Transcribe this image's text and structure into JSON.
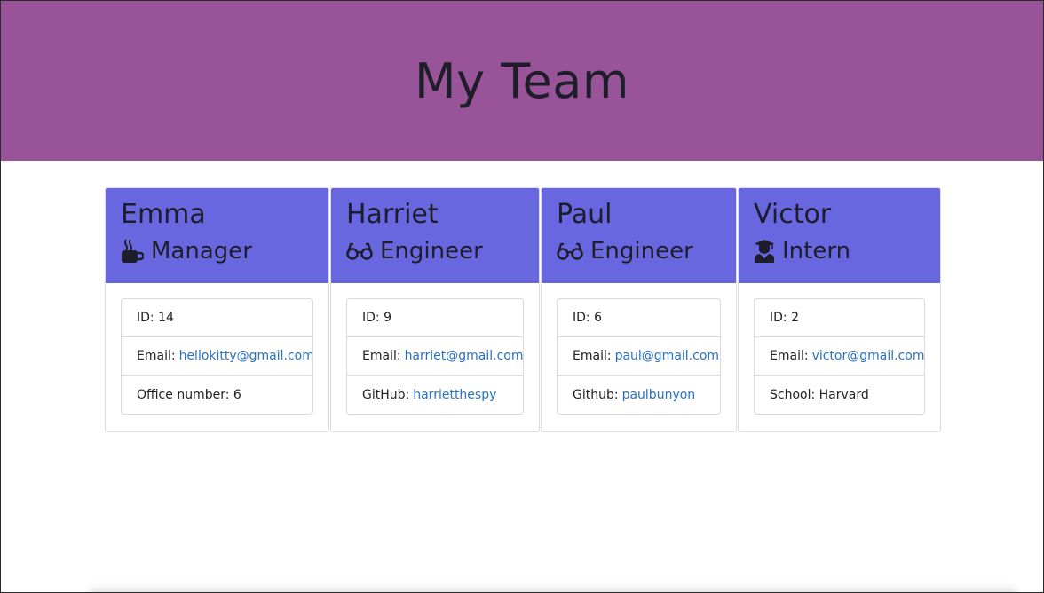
{
  "header": {
    "title": "My Team"
  },
  "colors": {
    "header_bg": "#985399",
    "card_head_bg": "#6967e0",
    "link": "#2672c8"
  },
  "cards": [
    {
      "name": "Emma",
      "role": "Manager",
      "icon": "coffee-mug-icon",
      "id_label": "ID:",
      "id_value": "14",
      "email_label": "Email:",
      "email_value": "hellokitty@gmail.com",
      "extra_label": "Office number:",
      "extra_value": "6"
    },
    {
      "name": "Harriet",
      "role": "Engineer",
      "icon": "glasses-icon",
      "id_label": "ID:",
      "id_value": "9",
      "email_label": "Email:",
      "email_value": "harriet@gmail.com",
      "extra_label": "GitHub:",
      "extra_value": "harrietthespy"
    },
    {
      "name": "Paul",
      "role": "Engineer",
      "icon": "glasses-icon",
      "id_label": "ID:",
      "id_value": "6",
      "email_label": "Email:",
      "email_value": "paul@gmail.com",
      "extra_label": "Github:",
      "extra_value": "paulbunyon"
    },
    {
      "name": "Victor",
      "role": "Intern",
      "icon": "graduate-icon",
      "id_label": "ID:",
      "id_value": "2",
      "email_label": "Email:",
      "email_value": "victor@gmail.com",
      "extra_label": "School:",
      "extra_value": "Harvard"
    }
  ]
}
